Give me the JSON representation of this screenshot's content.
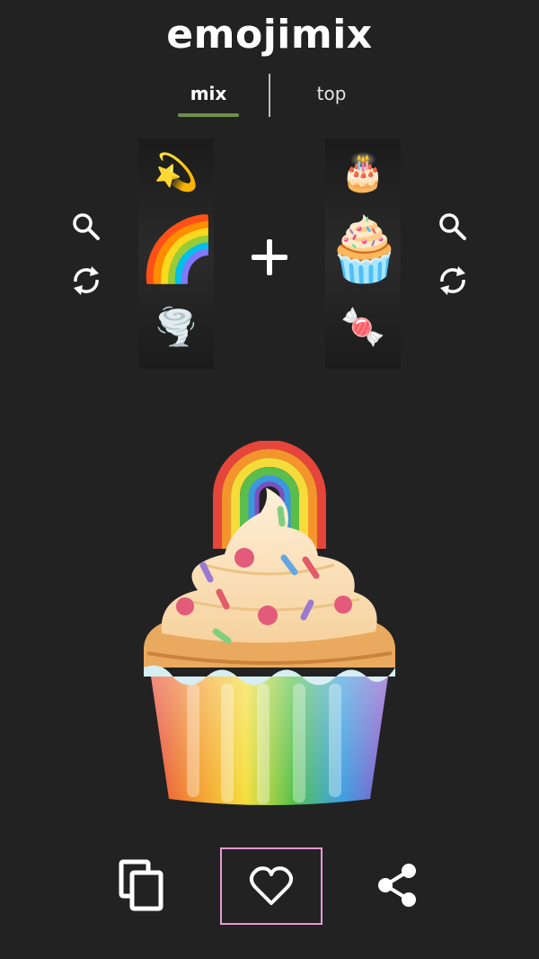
{
  "app": {
    "title": "emojimix"
  },
  "tabs": [
    {
      "label": "mix",
      "active": true
    },
    {
      "label": "top",
      "active": false
    }
  ],
  "colors": {
    "background": "#222222",
    "tab_active_indicator": "#6f8f4c",
    "selected_button_border": "#e79ad0"
  },
  "reels": {
    "left": {
      "items": [
        "💫",
        "🌈",
        "🌪️"
      ],
      "selected": "🌈"
    },
    "right": {
      "items": [
        "🎂",
        "🧁",
        "🍬"
      ],
      "selected": "🧁"
    }
  },
  "icons": {
    "left_search": "search-icon",
    "left_shuffle": "refresh-icon",
    "right_search": "search-icon",
    "right_shuffle": "refresh-icon",
    "plus": "plus-icon",
    "copy": "copy-icon",
    "like": "heart-icon",
    "share": "share-icon"
  },
  "result": {
    "emoji": "rainbow-cupcake"
  }
}
